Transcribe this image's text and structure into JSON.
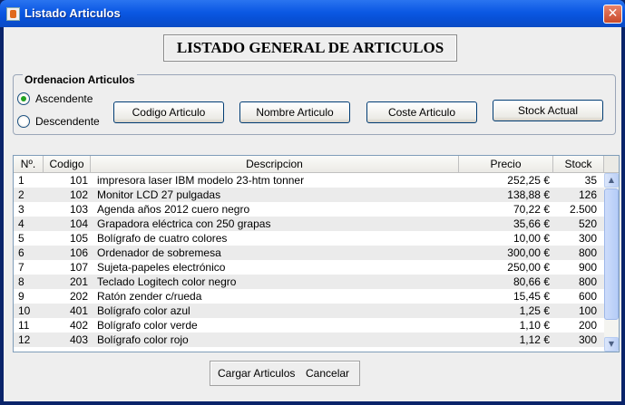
{
  "window": {
    "title": "Listado Articulos",
    "close_glyph": "✕"
  },
  "heading": "LISTADO GENERAL DE ARTICULOS",
  "ordering": {
    "title": "Ordenacion Articulos",
    "asc_label": "Ascendente",
    "desc_label": "Descendente",
    "selected": "Ascendente",
    "buttons": {
      "codigo": "Codigo Articulo",
      "nombre": "Nombre Articulo",
      "coste": "Coste Articulo",
      "stock": "Stock Actual"
    }
  },
  "table": {
    "headers": {
      "n": "Nº.",
      "codigo": "Codigo",
      "descripcion": "Descripcion",
      "precio": "Precio",
      "stock": "Stock"
    },
    "rows": [
      {
        "n": "1",
        "codigo": "101",
        "descripcion": "impresora laser IBM modelo 23-htm tonner",
        "precio": "252,25 €",
        "stock": "35"
      },
      {
        "n": "2",
        "codigo": "102",
        "descripcion": "Monitor LCD 27 pulgadas",
        "precio": "138,88 €",
        "stock": "126"
      },
      {
        "n": "3",
        "codigo": "103",
        "descripcion": "Agenda años 2012 cuero negro",
        "precio": "70,22 €",
        "stock": "2.500"
      },
      {
        "n": "4",
        "codigo": "104",
        "descripcion": "Grapadora eléctrica con 250 grapas",
        "precio": "35,66 €",
        "stock": "520"
      },
      {
        "n": "5",
        "codigo": "105",
        "descripcion": "Bolígrafo de cuatro colores",
        "precio": "10,00 €",
        "stock": "300"
      },
      {
        "n": "6",
        "codigo": "106",
        "descripcion": "Ordenador de sobremesa",
        "precio": "300,00 €",
        "stock": "800"
      },
      {
        "n": "7",
        "codigo": "107",
        "descripcion": "Sujeta-papeles electrónico",
        "precio": "250,00 €",
        "stock": "900"
      },
      {
        "n": "8",
        "codigo": "201",
        "descripcion": "Teclado Logitech color negro",
        "precio": "80,66 €",
        "stock": "800"
      },
      {
        "n": "9",
        "codigo": "202",
        "descripcion": "Ratón zender c/rueda",
        "precio": "15,45 €",
        "stock": "600"
      },
      {
        "n": "10",
        "codigo": "401",
        "descripcion": "Bolígrafo color azul",
        "precio": "1,25 €",
        "stock": "100"
      },
      {
        "n": "11",
        "codigo": "402",
        "descripcion": "Bolígrafo color verde",
        "precio": "1,10 €",
        "stock": "200"
      },
      {
        "n": "12",
        "codigo": "403",
        "descripcion": "Bolígrafo color rojo",
        "precio": "1,12 €",
        "stock": "300"
      }
    ],
    "scroll_up": "▲",
    "scroll_down": "▼"
  },
  "footer": {
    "cargar": "Cargar Articulos",
    "cancelar": "Cancelar"
  }
}
